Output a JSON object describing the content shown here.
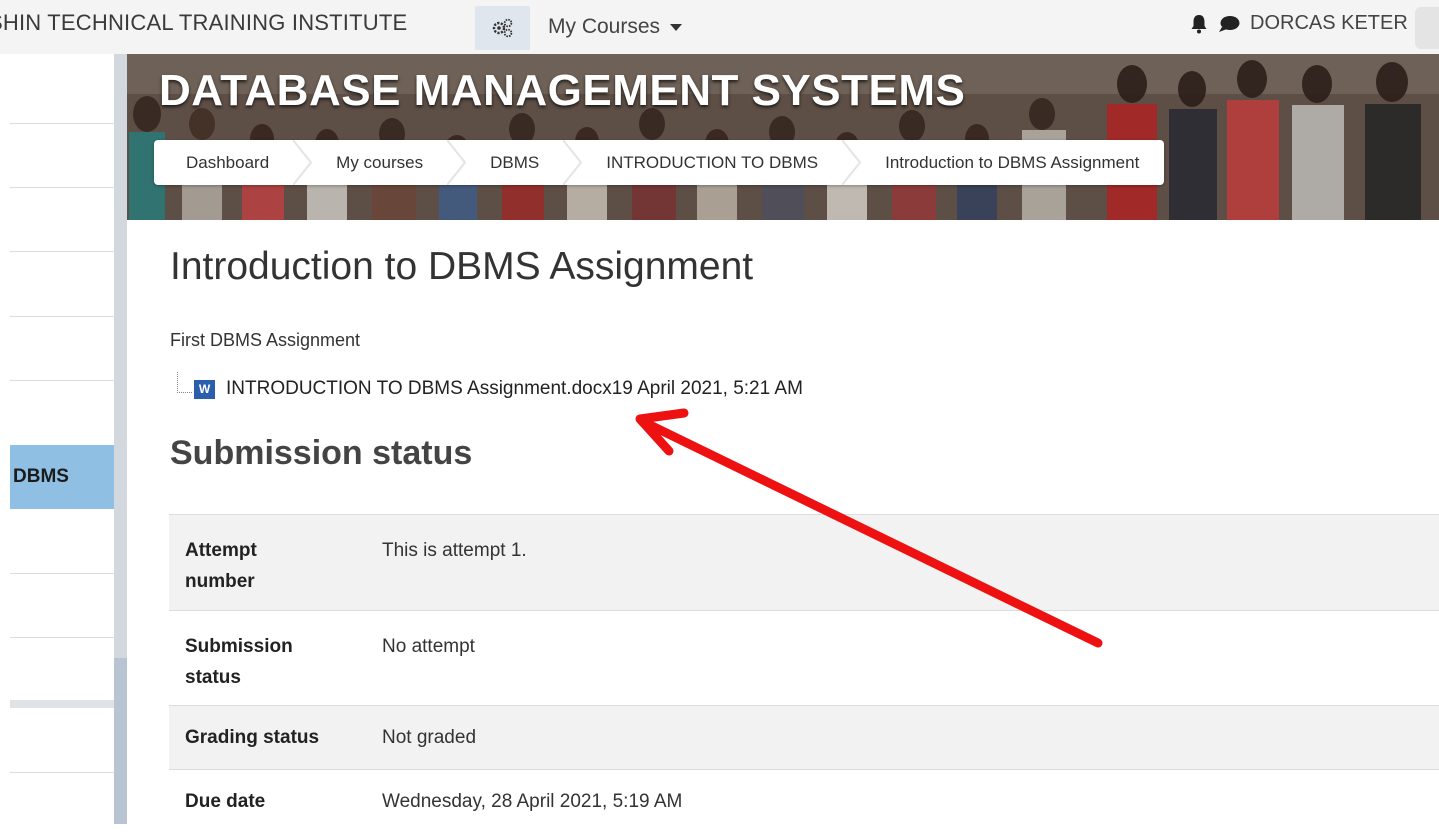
{
  "topbar": {
    "site_name": "SHIN TECHNICAL TRAINING INSTITUTE",
    "my_courses": "My Courses",
    "user_name": "DORCAS KETER"
  },
  "drawer": {
    "active_item": "DBMS"
  },
  "header": {
    "course_title": "DATABASE MANAGEMENT SYSTEMS",
    "breadcrumbs": [
      "Dashboard",
      "My courses",
      "DBMS",
      "INTRODUCTION TO DBMS",
      "Introduction to DBMS Assignment"
    ]
  },
  "main": {
    "title": "Introduction to DBMS Assignment",
    "intro": "First DBMS Assignment",
    "file": {
      "name": "INTRODUCTION TO DBMS Assignment.docx",
      "date": "19 April 2021, 5:21 AM",
      "icon_letter": "W"
    },
    "section_title": "Submission status",
    "status_rows": [
      {
        "label": "Attempt number",
        "value": "This is attempt 1."
      },
      {
        "label": "Submission status",
        "value": "No attempt"
      },
      {
        "label": "Grading status",
        "value": "Not graded"
      },
      {
        "label": "Due date",
        "value": "Wednesday, 28 April 2021, 5:19 AM"
      }
    ]
  },
  "colors": {
    "accent_active": "#8fbfe3",
    "annotation_arrow": "#ee1111",
    "word_icon": "#2b5fad"
  }
}
